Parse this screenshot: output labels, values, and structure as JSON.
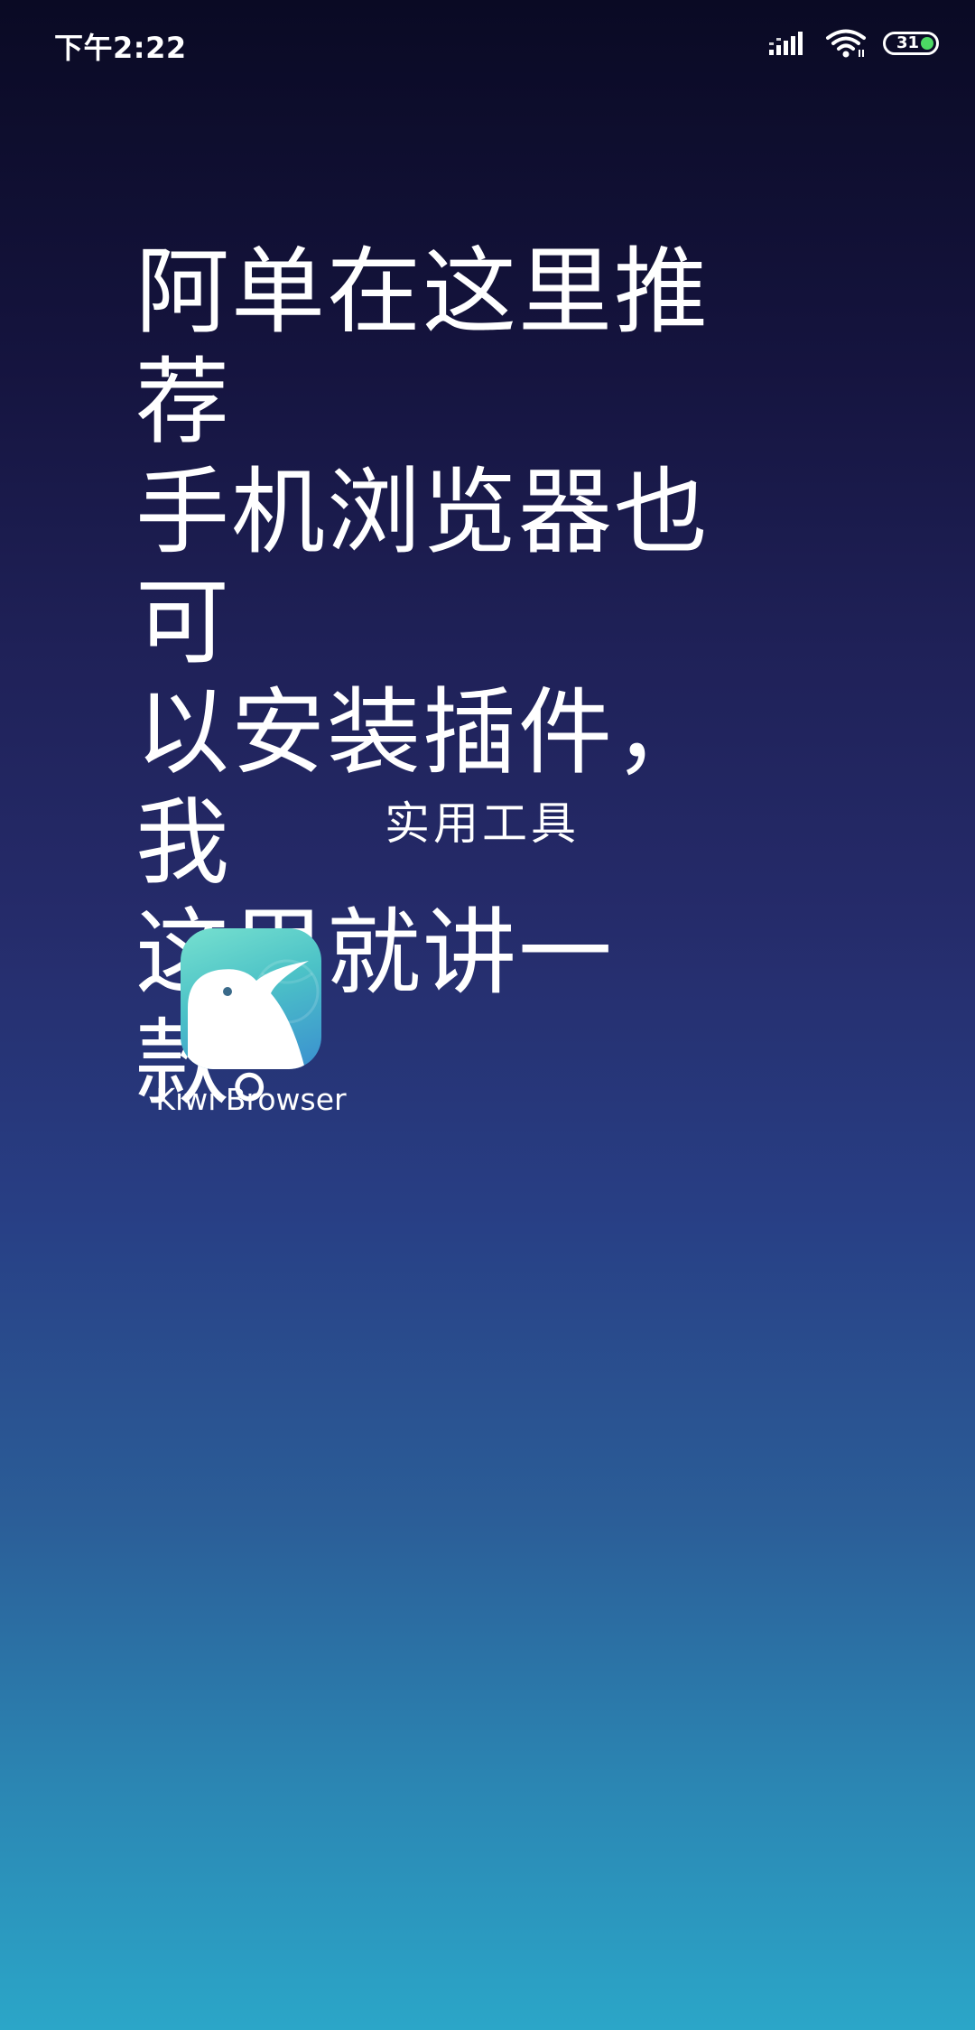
{
  "status_bar": {
    "time": "下午2:22",
    "battery_level": "31",
    "icons": [
      "signal-icon",
      "wifi-icon",
      "battery-icon"
    ],
    "battery_color": "#4cd964"
  },
  "headline": {
    "line1": "阿单在这里推荐",
    "line2": "手机浏览器也可",
    "line3": "以安装插件，我",
    "line4": "这里就讲一款。"
  },
  "folder": {
    "title": "实用工具",
    "apps": [
      {
        "label": "Kiwi Browser",
        "icon": "kiwi-browser-icon"
      }
    ]
  }
}
